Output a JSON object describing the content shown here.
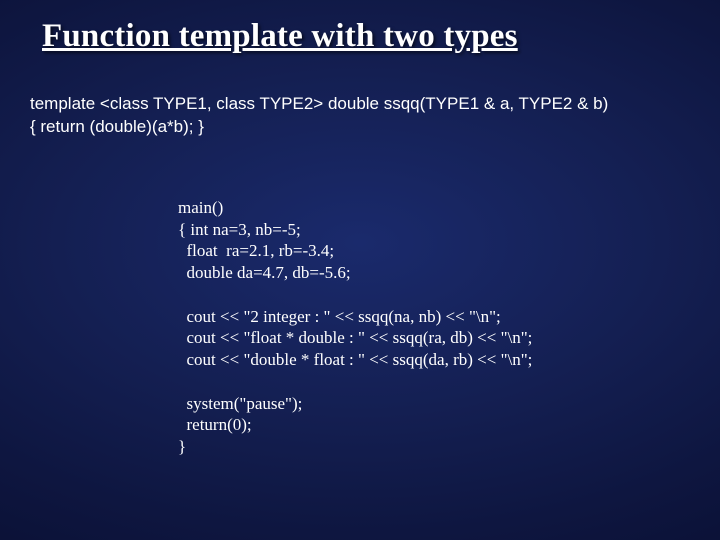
{
  "title": "Function template with two types",
  "declaration": {
    "line1": "template <class TYPE1, class TYPE2> double ssqq(TYPE1 & a, TYPE2 & b)",
    "line2": "{ return (double)(a*b); }"
  },
  "code": "main()\n{ int na=3, nb=-5;\n  float  ra=2.1, rb=-3.4;\n  double da=4.7, db=-5.6;\n\n  cout << \"2 integer : \" << ssqq(na, nb) << \"\\n\";\n  cout << \"float * double : \" << ssqq(ra, db) << \"\\n\";\n  cout << \"double * float : \" << ssqq(da, rb) << \"\\n\";\n\n  system(\"pause\");\n  return(0);\n}"
}
